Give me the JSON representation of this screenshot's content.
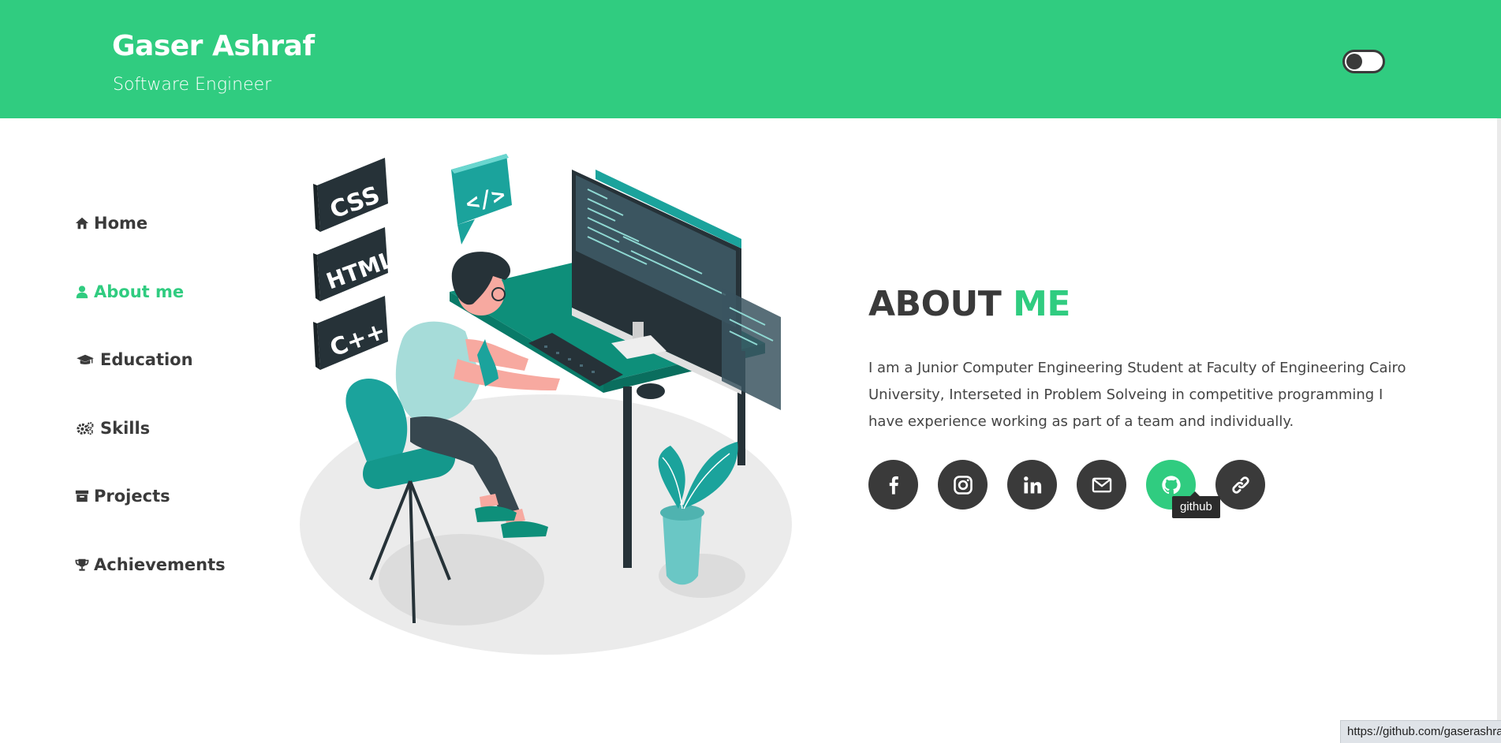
{
  "header": {
    "name": "Gaser Ashraf",
    "role": "Software Engineer",
    "theme_toggle": "off"
  },
  "nav": {
    "items": [
      {
        "label": "Home",
        "icon": "home-icon"
      },
      {
        "label": "About me",
        "icon": "user-icon",
        "active": true
      },
      {
        "label": "Education",
        "icon": "graduation-cap-icon"
      },
      {
        "label": "Skills",
        "icon": "gears-icon"
      },
      {
        "label": "Projects",
        "icon": "archive-icon"
      },
      {
        "label": "Achievements",
        "icon": "trophy-icon"
      }
    ]
  },
  "illustration": {
    "badges": [
      "CSS",
      "HTML",
      "C++"
    ],
    "code_bubble": "</>"
  },
  "about": {
    "title_main": "ABOUT",
    "title_accent": "ME",
    "text": "I am a Junior Computer Engineering Student at Faculty of Engineering Cairo University, Interseted in Problem Solveing in competitive programming I have experience working as part of a team and individually."
  },
  "socials": [
    {
      "name": "facebook",
      "icon": "facebook-icon"
    },
    {
      "name": "instagram",
      "icon": "instagram-icon"
    },
    {
      "name": "linkedin",
      "icon": "linkedin-icon"
    },
    {
      "name": "email",
      "icon": "mail-icon"
    },
    {
      "name": "github",
      "icon": "github-icon",
      "hovered": true
    },
    {
      "name": "link",
      "icon": "link-icon"
    }
  ],
  "tooltip": "github",
  "status_url": "https://github.com/gaserashraf",
  "colors": {
    "accent": "#30cc80",
    "dark": "#3a3a3a",
    "teal": "#1ba39c"
  }
}
